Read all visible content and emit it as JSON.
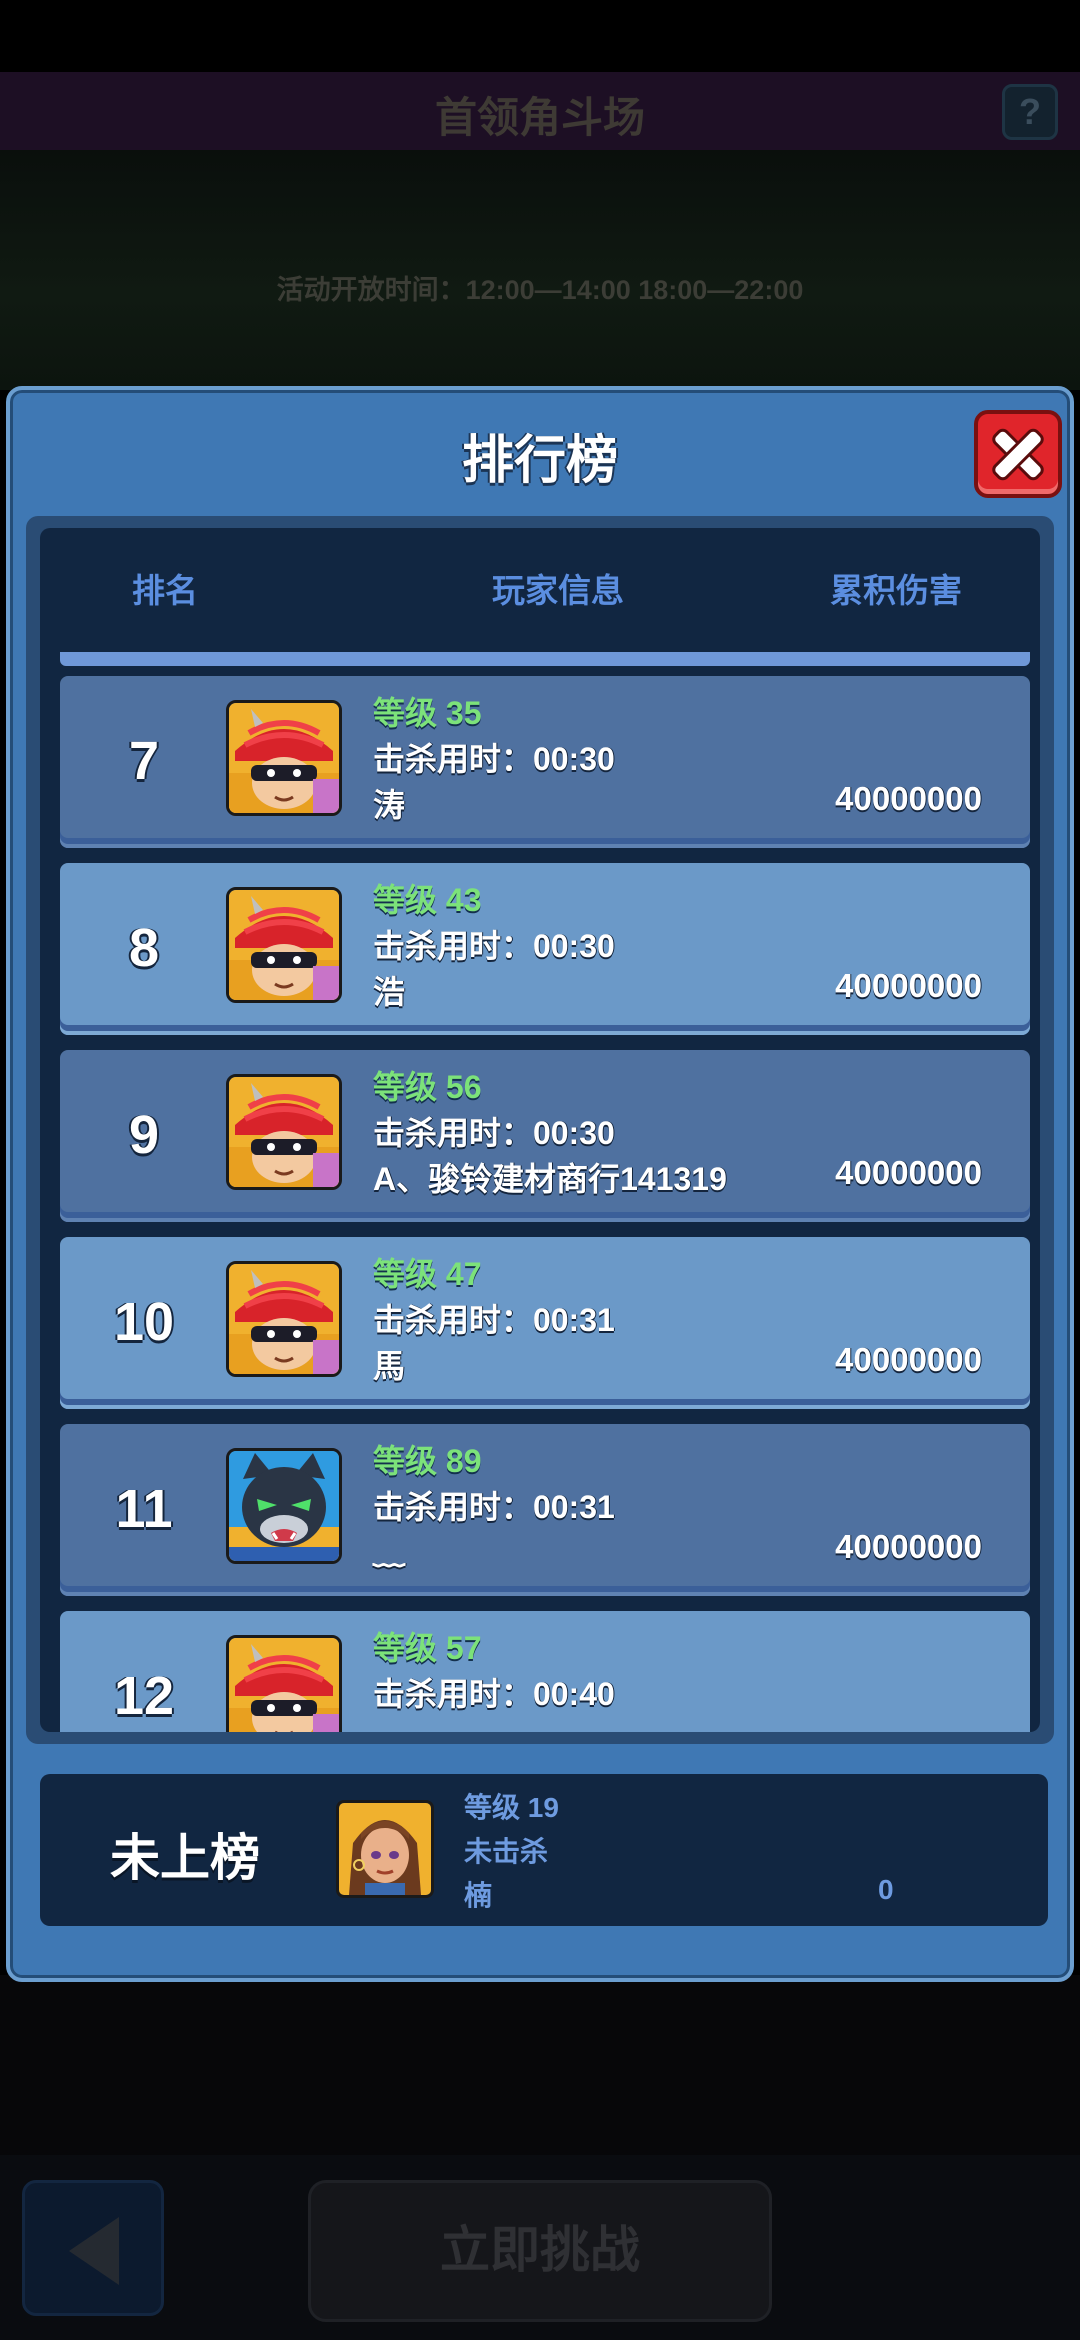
{
  "background": {
    "title": "首领角斗场",
    "help_label": "?",
    "open_time": "活动开放时间：12:00—14:00 18:00—22:00",
    "challenge_label": "立即挑战"
  },
  "modal": {
    "title": "排行榜",
    "headers": {
      "rank": "排名",
      "player": "玩家信息",
      "damage": "累积伤害"
    },
    "rows": [
      {
        "rank": "7",
        "level": "等级 35",
        "kill_time": "击杀用时：00:30",
        "name": "涛",
        "damage": "40000000",
        "avatar": "red-hat-hero-icon"
      },
      {
        "rank": "8",
        "level": "等级 43",
        "kill_time": "击杀用时：00:30",
        "name": "浩",
        "damage": "40000000",
        "avatar": "red-hat-hero-icon"
      },
      {
        "rank": "9",
        "level": "等级 56",
        "kill_time": "击杀用时：00:30",
        "name": "A、骏铃建材商行141319",
        "damage": "40000000",
        "avatar": "red-hat-hero-icon"
      },
      {
        "rank": "10",
        "level": "等级 47",
        "kill_time": "击杀用时：00:31",
        "name": "馬",
        "damage": "40000000",
        "avatar": "red-hat-hero-icon"
      },
      {
        "rank": "11",
        "level": "等级 89",
        "kill_time": "击杀用时：00:31",
        "name": "﹏",
        "damage": "40000000",
        "avatar": "black-cat-hero-icon"
      },
      {
        "rank": "12",
        "level": "等级 57",
        "kill_time": "击杀用时：00:40",
        "name": "",
        "damage": "",
        "avatar": "red-hat-hero-icon"
      }
    ],
    "self": {
      "rank": "未上榜",
      "level": "等级 19",
      "kill": "未击杀",
      "name": "楠",
      "damage": "0",
      "avatar": "girl-hero-icon"
    }
  },
  "colors": {
    "level_green": "#7ce27a",
    "panel_blue": "#3f78b4",
    "close_red": "#e0252b"
  }
}
